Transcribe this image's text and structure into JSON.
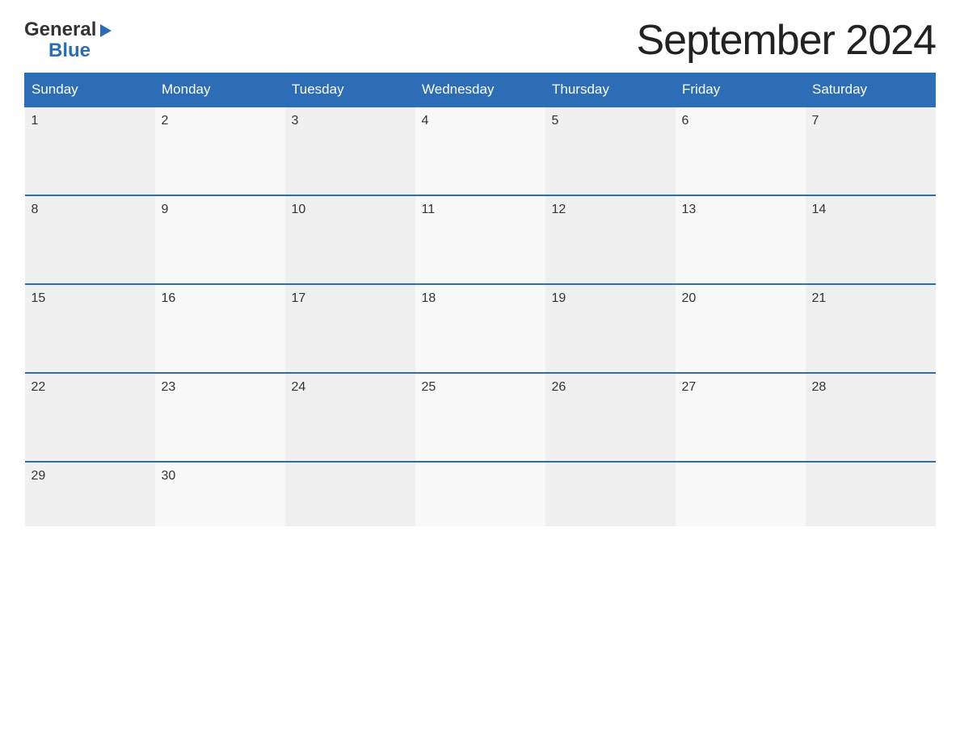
{
  "logo": {
    "general_text": "General",
    "blue_text": "Blue"
  },
  "title": "September 2024",
  "days_of_week": [
    "Sunday",
    "Monday",
    "Tuesday",
    "Wednesday",
    "Thursday",
    "Friday",
    "Saturday"
  ],
  "weeks": [
    [
      {
        "date": "1",
        "empty": false
      },
      {
        "date": "2",
        "empty": false
      },
      {
        "date": "3",
        "empty": false
      },
      {
        "date": "4",
        "empty": false
      },
      {
        "date": "5",
        "empty": false
      },
      {
        "date": "6",
        "empty": false
      },
      {
        "date": "7",
        "empty": false
      }
    ],
    [
      {
        "date": "8",
        "empty": false
      },
      {
        "date": "9",
        "empty": false
      },
      {
        "date": "10",
        "empty": false
      },
      {
        "date": "11",
        "empty": false
      },
      {
        "date": "12",
        "empty": false
      },
      {
        "date": "13",
        "empty": false
      },
      {
        "date": "14",
        "empty": false
      }
    ],
    [
      {
        "date": "15",
        "empty": false
      },
      {
        "date": "16",
        "empty": false
      },
      {
        "date": "17",
        "empty": false
      },
      {
        "date": "18",
        "empty": false
      },
      {
        "date": "19",
        "empty": false
      },
      {
        "date": "20",
        "empty": false
      },
      {
        "date": "21",
        "empty": false
      }
    ],
    [
      {
        "date": "22",
        "empty": false
      },
      {
        "date": "23",
        "empty": false
      },
      {
        "date": "24",
        "empty": false
      },
      {
        "date": "25",
        "empty": false
      },
      {
        "date": "26",
        "empty": false
      },
      {
        "date": "27",
        "empty": false
      },
      {
        "date": "28",
        "empty": false
      }
    ],
    [
      {
        "date": "29",
        "empty": false
      },
      {
        "date": "30",
        "empty": false
      },
      {
        "date": "",
        "empty": true
      },
      {
        "date": "",
        "empty": true
      },
      {
        "date": "",
        "empty": true
      },
      {
        "date": "",
        "empty": true
      },
      {
        "date": "",
        "empty": true
      }
    ]
  ]
}
